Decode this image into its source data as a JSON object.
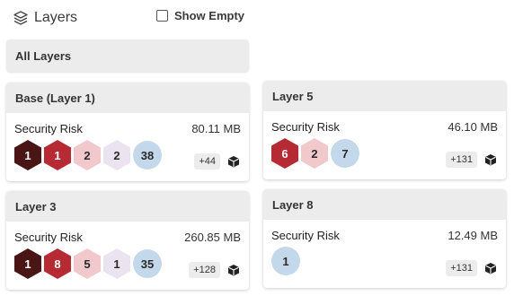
{
  "header": {
    "title": "Layers",
    "show_empty_label": "Show Empty",
    "show_empty_checked": false
  },
  "all_layers": {
    "label": "All Layers"
  },
  "risk_colors": {
    "critical": {
      "bg": "#4a1515",
      "fg": "#ffffff"
    },
    "high": {
      "bg": "#b52a33",
      "fg": "#ffffff"
    },
    "medium": {
      "bg": "#f1c8cc",
      "fg": "#2a2a2a"
    },
    "low": {
      "bg": "#ece3f1",
      "fg": "#2a2a2a"
    },
    "negligible": {
      "bg": "#c4d8eb",
      "fg": "#2a2a2a"
    }
  },
  "layers": [
    {
      "name": "Base (Layer 1)",
      "risk_label": "Security Risk",
      "size": "80.11 MB",
      "counts": [
        {
          "level": "critical",
          "value": "1"
        },
        {
          "level": "high",
          "value": "1"
        },
        {
          "level": "medium",
          "value": "2"
        },
        {
          "level": "low",
          "value": "2"
        },
        {
          "level": "negligible",
          "value": "38"
        }
      ],
      "more": "+44",
      "icon": "package-icon"
    },
    {
      "name": "Layer 3",
      "risk_label": "Security Risk",
      "size": "260.85 MB",
      "counts": [
        {
          "level": "critical",
          "value": "1"
        },
        {
          "level": "high",
          "value": "8"
        },
        {
          "level": "medium",
          "value": "5"
        },
        {
          "level": "low",
          "value": "1"
        },
        {
          "level": "negligible",
          "value": "35"
        }
      ],
      "more": "+128",
      "icon": "package-icon"
    },
    {
      "name": "Layer 5",
      "risk_label": "Security Risk",
      "size": "46.10 MB",
      "counts": [
        {
          "level": "high",
          "value": "6"
        },
        {
          "level": "medium",
          "value": "2"
        },
        {
          "level": "negligible",
          "value": "7"
        }
      ],
      "more": "+131",
      "icon": "package-icon"
    },
    {
      "name": "Layer 8",
      "risk_label": "Security Risk",
      "size": "12.49 MB",
      "counts": [
        {
          "level": "negligible",
          "value": "1"
        }
      ],
      "more": "+131",
      "icon": "package-icon"
    }
  ]
}
